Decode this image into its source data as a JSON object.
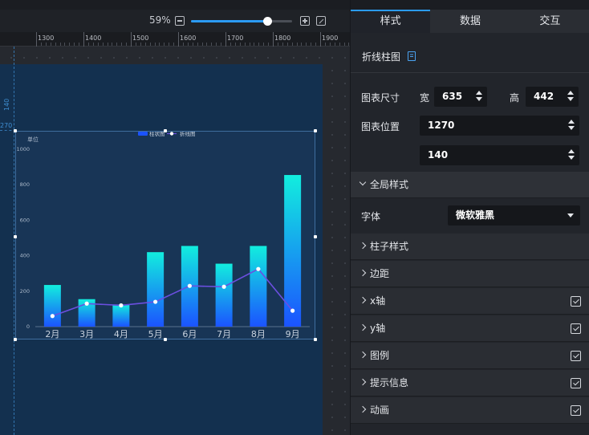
{
  "zoom": {
    "label": "59%",
    "level": 0.59
  },
  "ruler": {
    "labels": [
      "1300",
      "1400",
      "1500",
      "1600",
      "1700",
      "1800",
      "1900"
    ]
  },
  "guides": {
    "x_label": "140",
    "y_label": "270"
  },
  "colors": {
    "accent": "#2b9bf4",
    "bar_top": "#12eede",
    "bar_bottom": "#1b53ff",
    "line": "#6b4fe0",
    "screen_bg": "#13304f"
  },
  "chart_data": {
    "type": "bar",
    "title": "",
    "unit_label": "单位",
    "legend": [
      "柱状图",
      "折线图"
    ],
    "categories": [
      "2月",
      "3月",
      "4月",
      "5月",
      "6月",
      "7月",
      "8月",
      "9月"
    ],
    "yticks": [
      "0",
      "200",
      "400",
      "600",
      "800",
      "1000"
    ],
    "ylim": [
      0,
      1000
    ],
    "series": [
      {
        "name": "柱状图",
        "type": "bar",
        "values": [
          235,
          155,
          125,
          420,
          455,
          355,
          455,
          855
        ]
      },
      {
        "name": "折线图",
        "type": "line",
        "values": [
          60,
          130,
          120,
          140,
          230,
          225,
          325,
          90
        ]
      }
    ],
    "grid": false,
    "legend_position": "top"
  },
  "panel": {
    "tabs": [
      {
        "label": "样式",
        "active": true
      },
      {
        "label": "数据",
        "active": false
      },
      {
        "label": "交互",
        "active": false
      }
    ],
    "component_title": "折线柱图",
    "size": {
      "label": "图表尺寸",
      "width_label": "宽",
      "width": "635",
      "height_label": "高",
      "height": "442"
    },
    "position": {
      "label": "图表位置",
      "x": "1270",
      "y": "140"
    },
    "global": {
      "label": "全局样式",
      "font_label": "字体",
      "font_value": "微软雅黑"
    },
    "sections": [
      {
        "label": "柱子样式",
        "checkbox": false
      },
      {
        "label": "边距",
        "checkbox": false
      },
      {
        "label": "x轴",
        "checkbox": true
      },
      {
        "label": "y轴",
        "checkbox": true
      },
      {
        "label": "图例",
        "checkbox": true
      },
      {
        "label": "提示信息",
        "checkbox": true
      },
      {
        "label": "动画",
        "checkbox": true
      }
    ]
  }
}
